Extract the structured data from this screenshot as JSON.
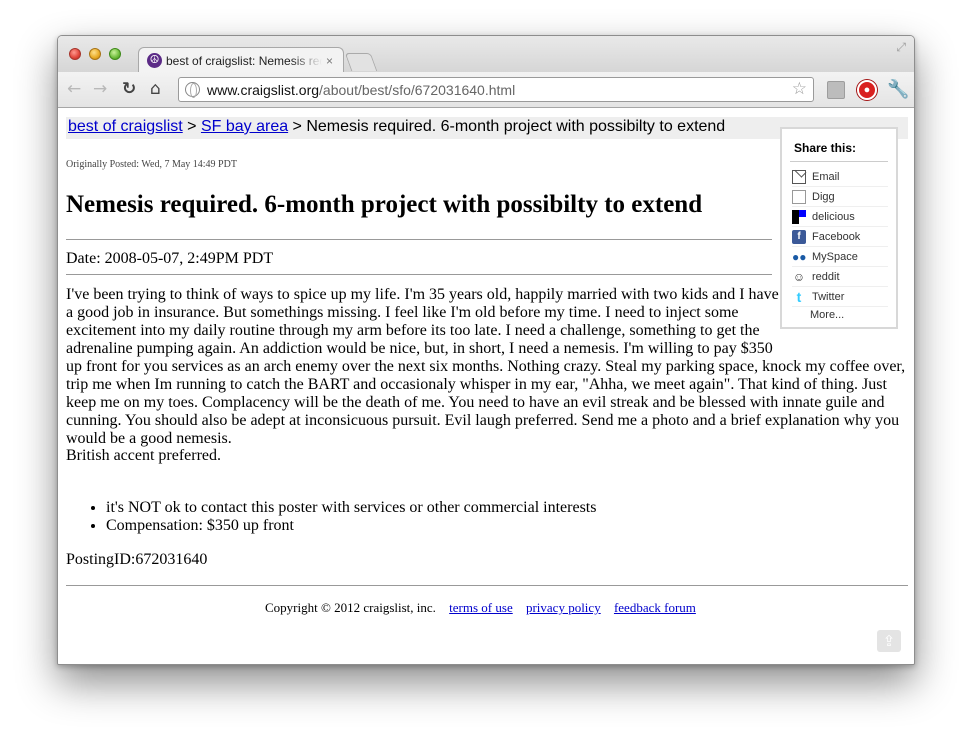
{
  "browser": {
    "tab_title": "best of craigslist: Nemesis required",
    "tab_close": "×",
    "url_host": "www.craigslist.org",
    "url_path": "/about/best/sfo/672031640.html",
    "icons": {
      "back": "←",
      "forward": "→",
      "reload": "↻",
      "home": "⌂",
      "star": "☆",
      "wrench": "🔧",
      "resize": "⤢"
    }
  },
  "breadcrumb": {
    "link1": "best of craigslist",
    "sep1": " > ",
    "link2": "SF bay area",
    "sep2": " > ",
    "current": "Nemesis required. 6-month project with possibilty to extend"
  },
  "post": {
    "originally_posted": "Originally Posted: Wed, 7 May 14:49 PDT",
    "title": "Nemesis required. 6-month project with possibilty to extend",
    "date": "Date: 2008-05-07, 2:49PM PDT",
    "body": "I've been trying to think of ways to spice up my life. I'm 35 years old, happily married with two kids and I have a good job in insurance. But somethings missing. I feel like I'm old before my time. I need to inject some excitement into my daily routine through my arm before its too late. I need a challenge, something to get the adrenaline pumping again. An addiction would be nice, but, in short, I need a nemesis. I'm willing to pay $350 up front for you services as an arch enemy over the next six months. Nothing crazy. Steal my parking space, knock my coffee over, trip me when Im running to catch the BART and occasionaly whisper in my ear, \"Ahha, we meet again\". That kind of thing. Just keep me on my toes. Complacency will be the death of me. You need to have an evil streak and be blessed with innate guile and cunning. You should also be adept at inconsicuous pursuit. Evil laugh preferred. Send me a photo and a brief explanation why you would be a good nemesis.",
    "accent": "British accent preferred.",
    "bullets": [
      "it's NOT ok to contact this poster with services or other commercial interests",
      "Compensation: $350 up front"
    ],
    "posting_id": "PostingID:672031640"
  },
  "share": {
    "title": "Share this:",
    "items": [
      {
        "label": "Email",
        "icon": "email-icon"
      },
      {
        "label": "Digg",
        "icon": "digg-icon"
      },
      {
        "label": "delicious",
        "icon": "delicious-icon"
      },
      {
        "label": "Facebook",
        "icon": "facebook-icon"
      },
      {
        "label": "MySpace",
        "icon": "myspace-icon"
      },
      {
        "label": "reddit",
        "icon": "reddit-icon"
      },
      {
        "label": "Twitter",
        "icon": "twitter-icon"
      }
    ],
    "more": "More..."
  },
  "footer": {
    "copyright": "Copyright © 2012 craigslist, inc.",
    "terms": "terms of use",
    "privacy": "privacy policy",
    "feedback": "feedback forum"
  },
  "colors": {
    "link": "#0000cc",
    "breadcrumb_bg": "#eeeeee",
    "ext_red": "#d9201f"
  }
}
